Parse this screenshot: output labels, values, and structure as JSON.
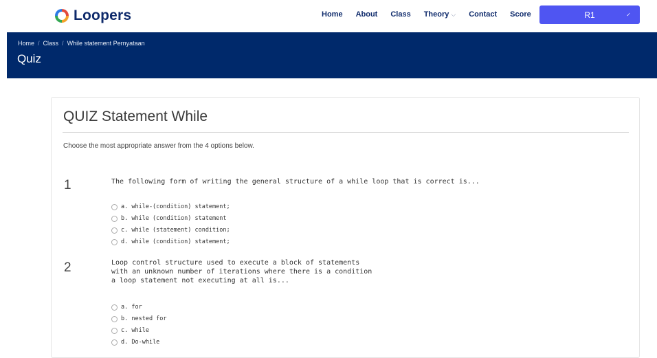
{
  "brand": {
    "name": "Loopers"
  },
  "nav": {
    "items": [
      "Home",
      "About",
      "Class",
      "Theory",
      "Contact",
      "Score"
    ],
    "user_label": "R1"
  },
  "banner": {
    "breadcrumb": [
      "Home",
      "Class",
      "While statement Pernyataan"
    ],
    "title": "Quiz"
  },
  "quiz": {
    "title": "QUIZ Statement While",
    "instructions": "Choose the most appropriate answer from the 4 options below.",
    "questions": [
      {
        "number": "1",
        "text": "The following form of writing the general structure of a while loop that is correct is...",
        "options": [
          "a. while-(condition) statement;",
          "b. while (condition) statement",
          "c. while (statement) condition;",
          "d. while (condition) statement;"
        ]
      },
      {
        "number": "2",
        "text": "Loop control structure used to execute a block of statements\nwith an unknown number of iterations where there is a condition\na loop statement not executing at all is...",
        "options": [
          "a. for",
          "b. nested for",
          "c. while",
          "d. Do-while"
        ]
      }
    ]
  }
}
